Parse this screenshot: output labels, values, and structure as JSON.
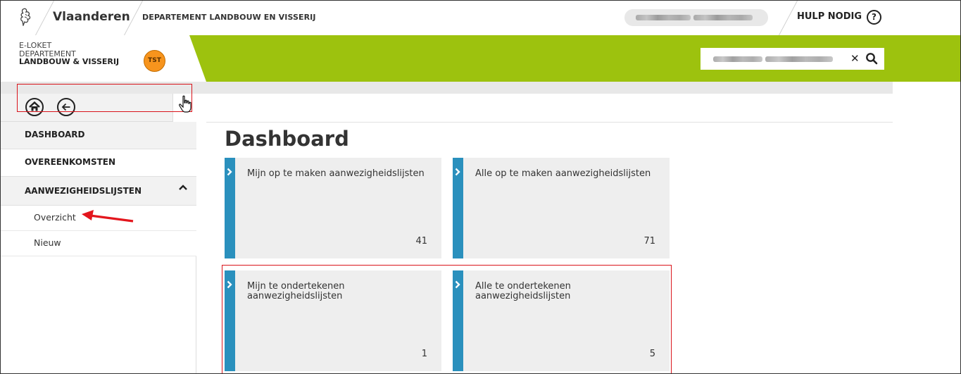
{
  "topbar": {
    "brand": "Vlaanderen",
    "department": "DEPARTEMENT LANDBOUW EN VISSERIJ",
    "help_label": "HULP NODIG",
    "help_icon": "question-circle-icon"
  },
  "banner": {
    "line1": "E-LOKET",
    "line2": "DEPARTEMENT",
    "line3": "LANDBOUW & VISSERIJ",
    "env_badge": "TST",
    "accent_color": "#9dc20e",
    "badge_color": "#f7941d"
  },
  "sidebar": {
    "items": [
      {
        "label": "DASHBOARD"
      },
      {
        "label": "OVEREENKOMSTEN"
      },
      {
        "label": "AANWEZIGHEIDSLIJSTEN"
      }
    ],
    "subitems": [
      {
        "label": "Overzicht"
      },
      {
        "label": "Nieuw"
      }
    ]
  },
  "main": {
    "title": "Dashboard",
    "tiles": [
      {
        "label": "Mijn op te maken aanwezigheidslijsten",
        "count": "41"
      },
      {
        "label": "Alle op te maken aanwezigheidslijsten",
        "count": "71"
      },
      {
        "label": "Mijn te ondertekenen aanwezigheidslijsten",
        "count": "1"
      },
      {
        "label": "Alle te ondertekenen aanwezigheidslijsten",
        "count": "5"
      }
    ],
    "tile_stripe_color": "#2a90bd",
    "highlight_color": "#d9141b"
  }
}
